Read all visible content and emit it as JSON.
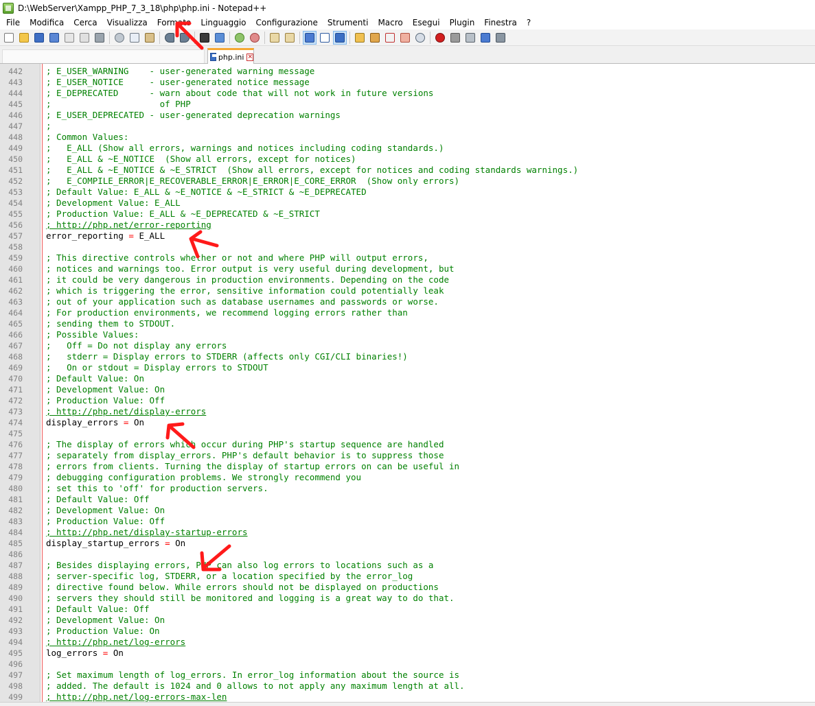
{
  "window": {
    "title": "D:\\WebServer\\Xampp_PHP_7_3_18\\php\\php.ini - Notepad++"
  },
  "menu": [
    "File",
    "Modifica",
    "Cerca",
    "Visualizza",
    "Formato",
    "Linguaggio",
    "Configurazione",
    "Strumenti",
    "Macro",
    "Esegui",
    "Plugin",
    "Finestra",
    "?"
  ],
  "toolbar_icons": [
    "new-file-icon",
    "open-file-icon",
    "save-icon",
    "save-all-icon",
    "close-icon",
    "close-all-icon",
    "print-icon",
    "cut-icon",
    "copy-icon",
    "paste-icon",
    "undo-icon",
    "redo-icon",
    "find-icon",
    "replace-icon",
    "zoom-in-icon",
    "zoom-out-icon",
    "sync-vertical-icon",
    "sync-horizontal-icon",
    "word-wrap-icon",
    "show-all-chars-icon",
    "indent-guide-icon",
    "user-language-icon",
    "document-map-icon",
    "function-list-icon",
    "folder-as-workspace-icon",
    "monitoring-icon",
    "record-macro-icon",
    "stop-record-icon",
    "play-macro-icon",
    "run-macro-multiple-icon",
    "save-macro-icon"
  ],
  "tabs": [
    {
      "label": "php.ini",
      "active": true
    }
  ],
  "colors": {
    "comment": "#008000",
    "directive": "#000000",
    "operator": "#ff0000",
    "line_number": "#808080",
    "gutter": "#e4e4e4",
    "edge_rule": "#ee5555",
    "active_tab_accent": "#f6a833",
    "annotation_arrow": "#ff1a1a"
  },
  "editor": {
    "lines": [
      {
        "n": "442",
        "t": "; E_USER_WARNING    - user-generated warning message",
        "k": "comment"
      },
      {
        "n": "443",
        "t": "; E_USER_NOTICE     - user-generated notice message",
        "k": "comment"
      },
      {
        "n": "444",
        "t": "; E_DEPRECATED      - warn about code that will not work in future versions",
        "k": "comment"
      },
      {
        "n": "445",
        "t": ";                     of PHP",
        "k": "comment"
      },
      {
        "n": "446",
        "t": "; E_USER_DEPRECATED - user-generated deprecation warnings",
        "k": "comment"
      },
      {
        "n": "447",
        "t": ";",
        "k": "comment"
      },
      {
        "n": "448",
        "t": "; Common Values:",
        "k": "comment"
      },
      {
        "n": "449",
        "t": ";   E_ALL (Show all errors, warnings and notices including coding standards.)",
        "k": "comment"
      },
      {
        "n": "450",
        "t": ";   E_ALL & ~E_NOTICE  (Show all errors, except for notices)",
        "k": "comment"
      },
      {
        "n": "451",
        "t": ";   E_ALL & ~E_NOTICE & ~E_STRICT  (Show all errors, except for notices and coding standards warnings.)",
        "k": "comment"
      },
      {
        "n": "452",
        "t": ";   E_COMPILE_ERROR|E_RECOVERABLE_ERROR|E_ERROR|E_CORE_ERROR  (Show only errors)",
        "k": "comment"
      },
      {
        "n": "453",
        "t": "; Default Value: E_ALL & ~E_NOTICE & ~E_STRICT & ~E_DEPRECATED",
        "k": "comment"
      },
      {
        "n": "454",
        "t": "; Development Value: E_ALL",
        "k": "comment"
      },
      {
        "n": "455",
        "t": "; Production Value: E_ALL & ~E_DEPRECATED & ~E_STRICT",
        "k": "comment"
      },
      {
        "n": "456",
        "t": "; http://php.net/error-reporting",
        "k": "url"
      },
      {
        "n": "457",
        "t": "error_reporting = E_ALL",
        "k": "directive"
      },
      {
        "n": "458",
        "t": "",
        "k": "blank"
      },
      {
        "n": "459",
        "t": "; This directive controls whether or not and where PHP will output errors,",
        "k": "comment"
      },
      {
        "n": "460",
        "t": "; notices and warnings too. Error output is very useful during development, but",
        "k": "comment"
      },
      {
        "n": "461",
        "t": "; it could be very dangerous in production environments. Depending on the code",
        "k": "comment"
      },
      {
        "n": "462",
        "t": "; which is triggering the error, sensitive information could potentially leak",
        "k": "comment"
      },
      {
        "n": "463",
        "t": "; out of your application such as database usernames and passwords or worse.",
        "k": "comment"
      },
      {
        "n": "464",
        "t": "; For production environments, we recommend logging errors rather than",
        "k": "comment"
      },
      {
        "n": "465",
        "t": "; sending them to STDOUT.",
        "k": "comment"
      },
      {
        "n": "466",
        "t": "; Possible Values:",
        "k": "comment"
      },
      {
        "n": "467",
        "t": ";   Off = Do not display any errors",
        "k": "comment"
      },
      {
        "n": "468",
        "t": ";   stderr = Display errors to STDERR (affects only CGI/CLI binaries!)",
        "k": "comment"
      },
      {
        "n": "469",
        "t": ";   On or stdout = Display errors to STDOUT",
        "k": "comment"
      },
      {
        "n": "470",
        "t": "; Default Value: On",
        "k": "comment"
      },
      {
        "n": "471",
        "t": "; Development Value: On",
        "k": "comment"
      },
      {
        "n": "472",
        "t": "; Production Value: Off",
        "k": "comment"
      },
      {
        "n": "473",
        "t": "; http://php.net/display-errors",
        "k": "url"
      },
      {
        "n": "474",
        "t": "display_errors = On",
        "k": "directive"
      },
      {
        "n": "475",
        "t": "",
        "k": "blank"
      },
      {
        "n": "476",
        "t": "; The display of errors which occur during PHP's startup sequence are handled",
        "k": "comment"
      },
      {
        "n": "477",
        "t": "; separately from display_errors. PHP's default behavior is to suppress those",
        "k": "comment"
      },
      {
        "n": "478",
        "t": "; errors from clients. Turning the display of startup errors on can be useful in",
        "k": "comment"
      },
      {
        "n": "479",
        "t": "; debugging configuration problems. We strongly recommend you",
        "k": "comment"
      },
      {
        "n": "480",
        "t": "; set this to 'off' for production servers.",
        "k": "comment"
      },
      {
        "n": "481",
        "t": "; Default Value: Off",
        "k": "comment"
      },
      {
        "n": "482",
        "t": "; Development Value: On",
        "k": "comment"
      },
      {
        "n": "483",
        "t": "; Production Value: Off",
        "k": "comment"
      },
      {
        "n": "484",
        "t": "; http://php.net/display-startup-errors",
        "k": "url"
      },
      {
        "n": "485",
        "t": "display_startup_errors = On",
        "k": "directive"
      },
      {
        "n": "486",
        "t": "",
        "k": "blank"
      },
      {
        "n": "487",
        "t": "; Besides displaying errors, PHP can also log errors to locations such as a",
        "k": "comment"
      },
      {
        "n": "488",
        "t": "; server-specific log, STDERR, or a location specified by the error_log",
        "k": "comment"
      },
      {
        "n": "489",
        "t": "; directive found below. While errors should not be displayed on productions",
        "k": "comment"
      },
      {
        "n": "490",
        "t": "; servers they should still be monitored and logging is a great way to do that.",
        "k": "comment"
      },
      {
        "n": "491",
        "t": "; Default Value: Off",
        "k": "comment"
      },
      {
        "n": "492",
        "t": "; Development Value: On",
        "k": "comment"
      },
      {
        "n": "493",
        "t": "; Production Value: On",
        "k": "comment"
      },
      {
        "n": "494",
        "t": "; http://php.net/log-errors",
        "k": "url"
      },
      {
        "n": "495",
        "t": "log_errors = On",
        "k": "directive"
      },
      {
        "n": "496",
        "t": "",
        "k": "blank"
      },
      {
        "n": "497",
        "t": "; Set maximum length of log_errors. In error_log information about the source is",
        "k": "comment"
      },
      {
        "n": "498",
        "t": "; added. The default is 1024 and 0 allows to not apply any maximum length at all.",
        "k": "comment"
      },
      {
        "n": "499",
        "t": "; http://php.net/log-errors-max-len",
        "k": "url"
      }
    ]
  }
}
